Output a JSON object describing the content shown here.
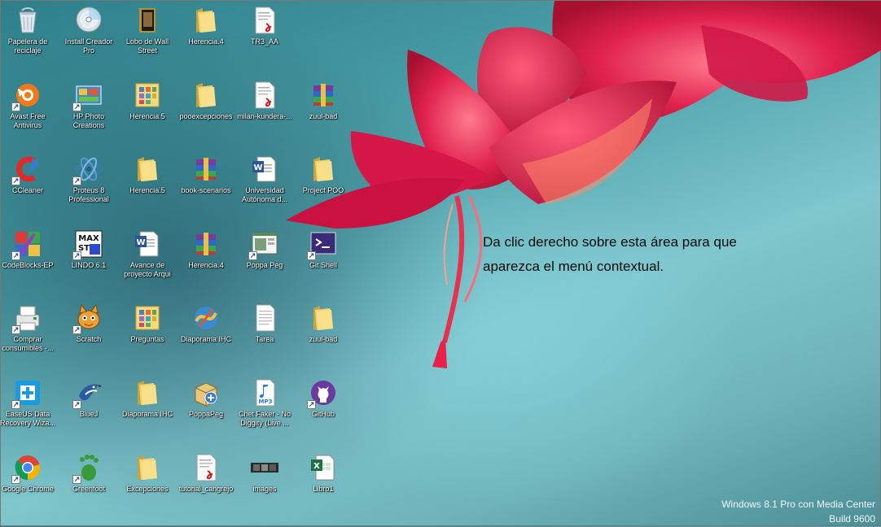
{
  "desktop": {
    "icons": [
      {
        "label": "Papelera de reciclaje",
        "icon": "recycle-bin-icon",
        "shortcut": false
      },
      {
        "label": "Install Creador Pro",
        "icon": "cd-install-icon",
        "shortcut": false
      },
      {
        "label": "Lobo de Wall Street",
        "icon": "movie-folder-icon",
        "shortcut": false
      },
      {
        "label": "Herencia.4",
        "icon": "folder-icon",
        "shortcut": false
      },
      {
        "label": "TR3_AA",
        "icon": "pdf-file-icon",
        "shortcut": false
      },
      {
        "label": "Avast Free Antivirus",
        "icon": "avast-icon",
        "shortcut": true
      },
      {
        "label": "HP Photo Creations",
        "icon": "hp-photo-icon",
        "shortcut": true
      },
      {
        "label": "Herencia.5",
        "icon": "grid-folder-icon",
        "shortcut": false
      },
      {
        "label": "pooexcepciones",
        "icon": "folder-icon",
        "shortcut": false
      },
      {
        "label": "milan-kundera-...",
        "icon": "pdf-file-icon",
        "shortcut": false
      },
      {
        "label": "zuul-bad",
        "icon": "archive-icon",
        "shortcut": false
      },
      {
        "label": "CCleaner",
        "icon": "ccleaner-icon",
        "shortcut": true
      },
      {
        "label": "Proteus 8 Professional",
        "icon": "proteus-icon",
        "shortcut": true
      },
      {
        "label": "Herencia.5",
        "icon": "folder-icon",
        "shortcut": false
      },
      {
        "label": "book-scenarios",
        "icon": "archive-icon",
        "shortcut": false
      },
      {
        "label": "Universidad Autónoma d...",
        "icon": "word-doc-icon",
        "shortcut": false
      },
      {
        "label": "Project POO",
        "icon": "folder-icon",
        "shortcut": false
      },
      {
        "label": "CodeBlocks-EP",
        "icon": "codeblocks-icon",
        "shortcut": true
      },
      {
        "label": "LINDO 6.1",
        "icon": "lindo-icon",
        "shortcut": true
      },
      {
        "label": "Avance de proyecto Arqui",
        "icon": "word-doc-icon",
        "shortcut": false
      },
      {
        "label": "Herencia.4",
        "icon": "archive-icon",
        "shortcut": false
      },
      {
        "label": "Poppa Peg",
        "icon": "app-window-icon",
        "shortcut": true
      },
      {
        "label": "Git Shell",
        "icon": "terminal-icon",
        "shortcut": true
      },
      {
        "label": "Comprar consumibles -...",
        "icon": "printer-icon",
        "shortcut": true
      },
      {
        "label": "Scratch",
        "icon": "scratch-cat-icon",
        "shortcut": true
      },
      {
        "label": "Preguntas",
        "icon": "grid-folder-icon",
        "shortcut": false
      },
      {
        "label": "Diaporama IHC",
        "icon": "flash-icon",
        "shortcut": false
      },
      {
        "label": "Tarea",
        "icon": "text-file-icon",
        "shortcut": false
      },
      {
        "label": "zuul-bad",
        "icon": "folder-icon",
        "shortcut": false
      },
      {
        "label": "EaseUS Data Recovery Wiza...",
        "icon": "easeus-icon",
        "shortcut": true
      },
      {
        "label": "BlueJ",
        "icon": "bluej-bird-icon",
        "shortcut": true
      },
      {
        "label": "Diaporama IHC",
        "icon": "folder-icon",
        "shortcut": false
      },
      {
        "label": "PoppaPeg",
        "icon": "installer-box-icon",
        "shortcut": false
      },
      {
        "label": "Chet Faker - No Diggity (Live ...",
        "icon": "mp3-file-icon",
        "shortcut": false
      },
      {
        "label": "GitHub",
        "icon": "github-icon",
        "shortcut": true
      },
      {
        "label": "Google Chrome",
        "icon": "chrome-icon",
        "shortcut": true
      },
      {
        "label": "Greenfoot",
        "icon": "greenfoot-icon",
        "shortcut": true
      },
      {
        "label": "Excepciones",
        "icon": "folder-icon",
        "shortcut": false
      },
      {
        "label": "tutorial_cangrejo",
        "icon": "pdf-file-icon",
        "shortcut": false
      },
      {
        "label": "images",
        "icon": "image-strip-icon",
        "shortcut": false
      },
      {
        "label": "Libro1",
        "icon": "excel-file-icon",
        "shortcut": false
      }
    ]
  },
  "hint": {
    "line1": "Da clic derecho sobre esta área para que",
    "line2": "aparezca el menú contextual."
  },
  "watermark": {
    "line1": "Windows 8.1 Pro con Media Center",
    "line2": "Build 9600"
  },
  "colors": {
    "wallpaper_teal": "#4ea2ab",
    "flower_red": "#e0224e",
    "text_dark": "#0a0a0a"
  }
}
